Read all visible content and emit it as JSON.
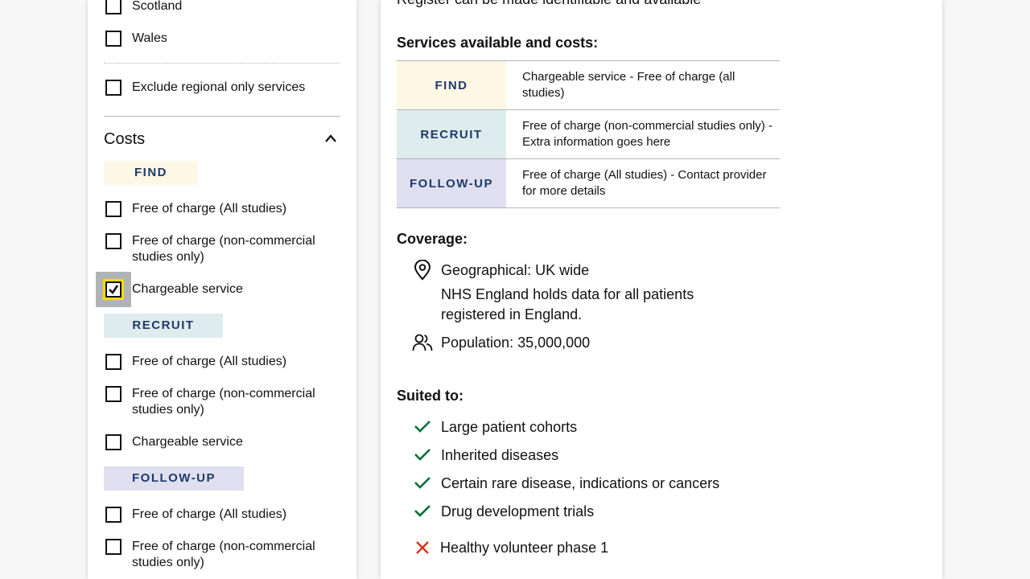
{
  "sidebar": {
    "nations": [
      {
        "label": "Scotland",
        "checked": false
      },
      {
        "label": "Wales",
        "checked": false
      }
    ],
    "exclude_regional": {
      "label": "Exclude regional only services",
      "checked": false
    },
    "costs": {
      "heading": "Costs",
      "toggle_icon": "chevron-up-icon",
      "groups": [
        {
          "tag": "FIND",
          "color": "#fff7e6",
          "options": [
            {
              "label": "Free of charge (All studies)",
              "checked": false
            },
            {
              "label": "Free of charge (non-commercial studies only)",
              "checked": false
            },
            {
              "label": "Chargeable service",
              "checked": true
            }
          ]
        },
        {
          "tag": "RECRUIT",
          "color": "#deeced",
          "options": [
            {
              "label": "Free of charge (All studies)",
              "checked": false
            },
            {
              "label": "Free of charge (non-commercial studies only)",
              "checked": false
            },
            {
              "label": "Chargeable service",
              "checked": false
            }
          ]
        },
        {
          "tag": "FOLLOW-UP",
          "color": "#dfdff0",
          "options": [
            {
              "label": "Free of charge (All studies)",
              "checked": false
            },
            {
              "label": "Free of charge (non-commercial studies only)",
              "checked": false
            }
          ]
        }
      ]
    }
  },
  "main": {
    "intro_fragment": "Register can be made identifiable and available",
    "services_heading": "Services available and costs:",
    "services": [
      {
        "tag": "FIND",
        "color": "#fff7e6",
        "description": "Chargeable service - Free of charge (all studies)"
      },
      {
        "tag": "RECRUIT",
        "color": "#deeced",
        "description": "Free of charge (non-commercial studies only) - Extra information goes here"
      },
      {
        "tag": "FOLLOW-UP",
        "color": "#dfdff0",
        "description": "Free of charge (All studies) - Contact provider for more details"
      }
    ],
    "coverage": {
      "heading": "Coverage:",
      "geographical": "Geographical: UK wide",
      "geo_note": "NHS England holds data for all patients registered in England.",
      "population": "Population: 35,000,000"
    },
    "suited": {
      "heading": "Suited to:",
      "yes": [
        "Large patient cohorts",
        "Inherited diseases",
        "Certain rare disease, indications or cancers",
        "Drug development trials"
      ],
      "no": [
        "Healthy volunteer phase 1"
      ],
      "yes_color": "#00703c",
      "no_color": "#d4351c"
    }
  }
}
